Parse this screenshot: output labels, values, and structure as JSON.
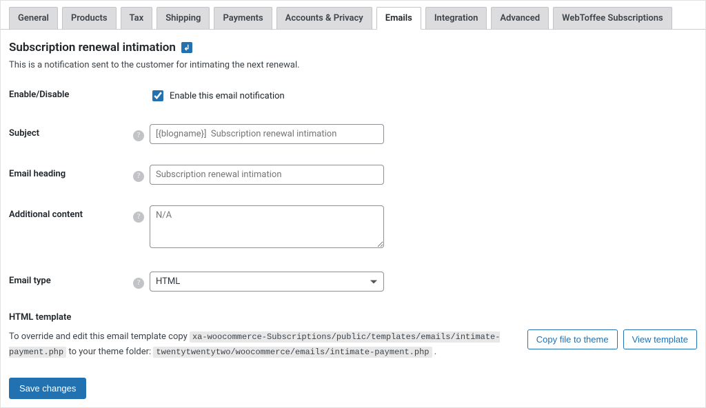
{
  "tabs": {
    "general": "General",
    "products": "Products",
    "tax": "Tax",
    "shipping": "Shipping",
    "payments": "Payments",
    "accounts": "Accounts & Privacy",
    "emails": "Emails",
    "integration": "Integration",
    "advanced": "Advanced",
    "webtoffee": "WebToffee Subscriptions"
  },
  "header": {
    "title": "Subscription renewal intimation",
    "back_glyph": "↲",
    "desc": "This is a notification sent to the customer for intimating the next renewal."
  },
  "form": {
    "enable": {
      "label": "Enable/Disable",
      "checkbox_label": "Enable this email notification",
      "checked": true
    },
    "subject": {
      "label": "Subject",
      "placeholder": "[{blogname}]  Subscription renewal intimation",
      "value": ""
    },
    "heading": {
      "label": "Email heading",
      "placeholder": "Subscription renewal intimation",
      "value": ""
    },
    "additional": {
      "label": "Additional content",
      "placeholder": "N/A",
      "value": ""
    },
    "type": {
      "label": "Email type",
      "value": "HTML"
    }
  },
  "template": {
    "heading": "HTML template",
    "prefix": "To override and edit this email template copy ",
    "path1": "xa-woocommerce-Subscriptions/public/templates/emails/intimate-payment.php",
    "mid": " to your theme folder: ",
    "path2": "twentytwentytwo/woocommerce/emails/intimate-payment.php",
    "suffix": " .",
    "copy_btn": "Copy file to theme",
    "view_btn": "View template"
  },
  "save_btn": "Save changes"
}
